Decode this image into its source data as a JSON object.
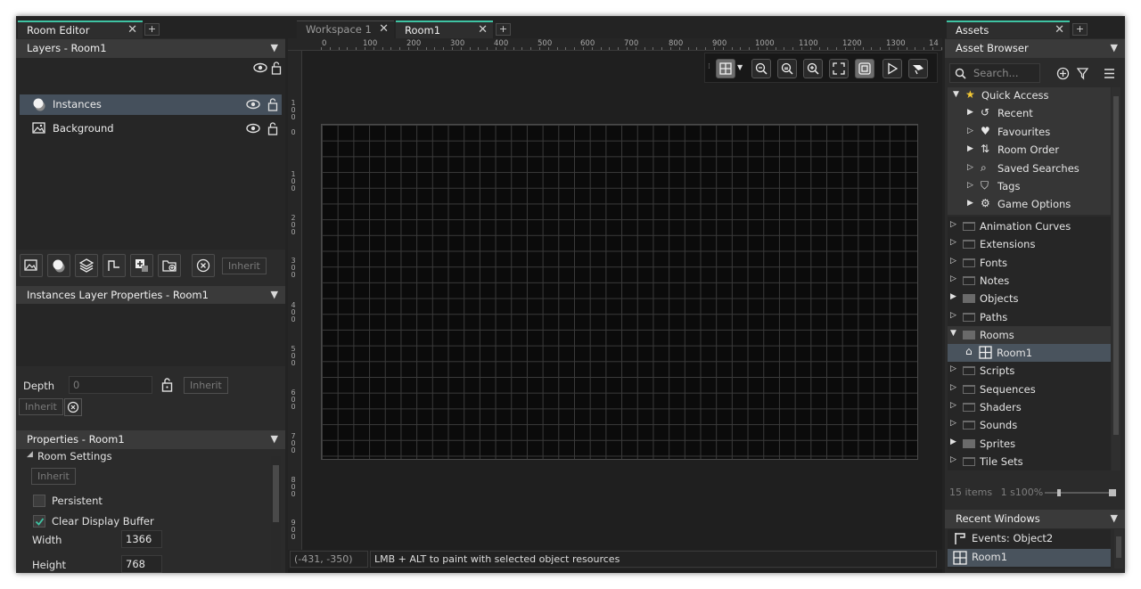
{
  "left": {
    "tab": "Room Editor",
    "layers_title": "Layers - Room1",
    "layers": [
      {
        "name": "Instances",
        "selected": true
      },
      {
        "name": "Background",
        "selected": false
      }
    ],
    "inherit_label": "Inherit",
    "instances_props_title": "Instances Layer Properties - Room1",
    "depth_label": "Depth",
    "depth_value": "0",
    "props_title": "Properties - Room1",
    "room_settings": "Room Settings",
    "persistent": "Persistent",
    "clear_display": "Clear Display Buffer",
    "width_label": "Width",
    "width_value": "1366",
    "height_label": "Height",
    "height_value": "768"
  },
  "center": {
    "tabs": [
      "Workspace 1",
      "Room1"
    ],
    "ruler_h": [
      "0",
      "100",
      "200",
      "300",
      "400",
      "500",
      "600",
      "700",
      "800",
      "900",
      "1000",
      "1100",
      "1200",
      "1300",
      "14"
    ],
    "ruler_v": [
      "100",
      "0",
      "100",
      "200",
      "300",
      "400",
      "500",
      "600",
      "700",
      "800",
      "900"
    ],
    "coords": "(-431, -350)",
    "status": "LMB + ALT to paint with selected object resources"
  },
  "right": {
    "tab": "Assets",
    "browser_title": "Asset Browser",
    "search_placeholder": "Search...",
    "quick_access": "Quick Access",
    "qa_items": [
      "Recent",
      "Favourites",
      "Room Order",
      "Saved Searches",
      "Tags",
      "Game Options"
    ],
    "folders": [
      "Animation Curves",
      "Extensions",
      "Fonts",
      "Notes",
      "Objects",
      "Paths",
      "Rooms",
      "Scripts",
      "Sequences",
      "Shaders",
      "Sounds",
      "Sprites",
      "Tile Sets"
    ],
    "room_child": "Room1",
    "items_count": "15 items",
    "selection_info": "1 s",
    "zoom": "100%",
    "recent_title": "Recent Windows",
    "recent": [
      "Events: Object2",
      "Room1"
    ]
  },
  "colors": {
    "accent": "#3fc3a3",
    "selection": "#45505c"
  }
}
